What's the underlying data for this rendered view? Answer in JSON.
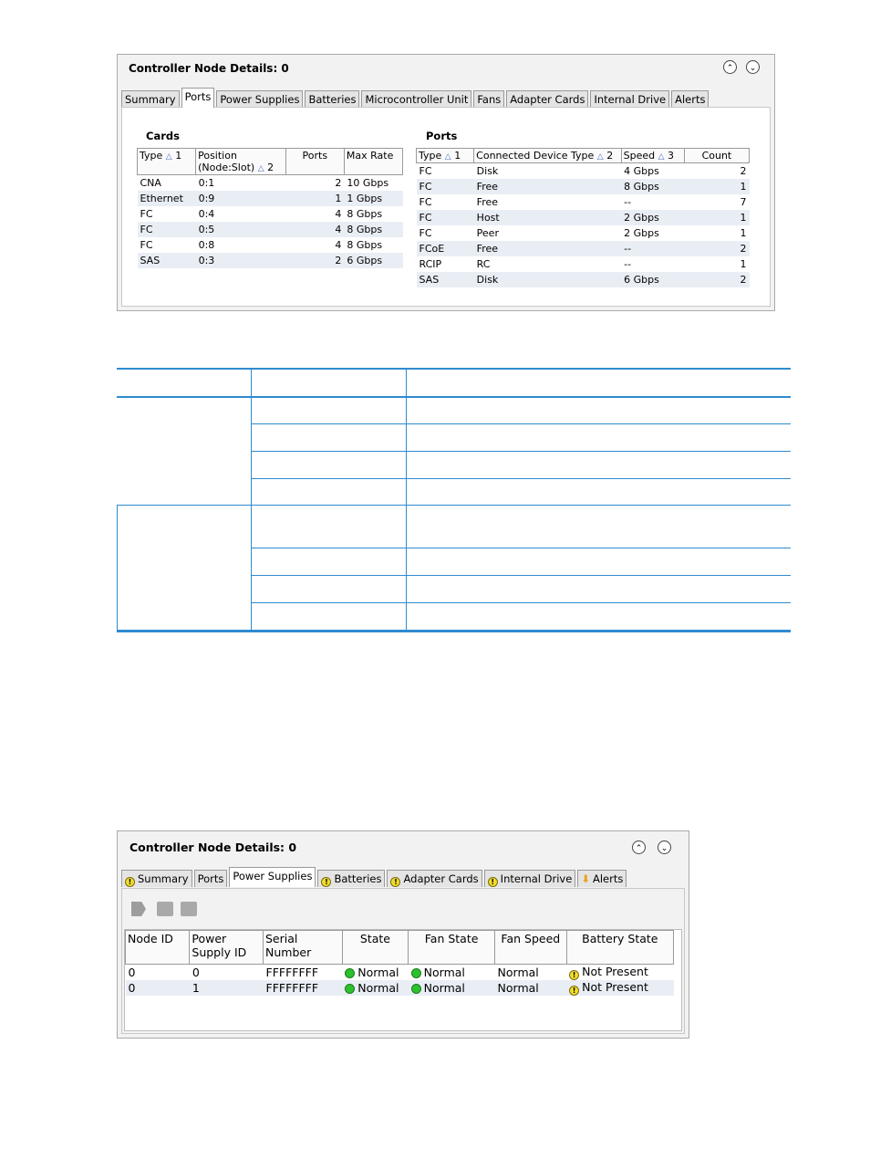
{
  "panel1": {
    "title": "Controller Node Details: 0",
    "tabs": [
      "Summary",
      "Ports",
      "Power Supplies",
      "Batteries",
      "Microcontroller Unit",
      "Fans",
      "Adapter Cards",
      "Internal Drive",
      "Alerts"
    ],
    "active_tab": "Ports",
    "cards": {
      "label": "Cards",
      "headers": [
        "Type",
        "1",
        "Position (Node:Slot)",
        "2",
        "Ports",
        "Max Rate"
      ],
      "rows": [
        [
          "CNA",
          "0:1",
          "2",
          "10 Gbps"
        ],
        [
          "Ethernet",
          "0:9",
          "1",
          "1 Gbps"
        ],
        [
          "FC",
          "0:4",
          "4",
          "8 Gbps"
        ],
        [
          "FC",
          "0:5",
          "4",
          "8 Gbps"
        ],
        [
          "FC",
          "0:8",
          "4",
          "8 Gbps"
        ],
        [
          "SAS",
          "0:3",
          "2",
          "6 Gbps"
        ]
      ]
    },
    "ports": {
      "label": "Ports",
      "headers": [
        "Type",
        "1",
        "Connected Device Type",
        "2",
        "Speed",
        "3",
        "Count"
      ],
      "rows": [
        [
          "FC",
          "Disk",
          "4 Gbps",
          "2"
        ],
        [
          "FC",
          "Free",
          "8 Gbps",
          "1"
        ],
        [
          "FC",
          "Free",
          "--",
          "7"
        ],
        [
          "FC",
          "Host",
          "2 Gbps",
          "1"
        ],
        [
          "FC",
          "Peer",
          "2 Gbps",
          "1"
        ],
        [
          "FCoE",
          "Free",
          "--",
          "2"
        ],
        [
          "RCIP",
          "RC",
          "--",
          "1"
        ],
        [
          "SAS",
          "Disk",
          "6 Gbps",
          "2"
        ]
      ]
    }
  },
  "panel2": {
    "title": "Controller Node Details: 0",
    "tabs": [
      "Summary",
      "Ports",
      "Power Supplies",
      "Batteries",
      "Adapter Cards",
      "Internal Drive",
      "Alerts"
    ],
    "active_tab": "Power Supplies",
    "toolbar_icons": [
      "export-icon",
      "print-icon",
      "copy-icon"
    ],
    "headers": [
      "Node ID",
      "Power Supply ID",
      "Serial Number",
      "State",
      "Fan State",
      "Fan Speed",
      "Battery State"
    ],
    "rows": [
      [
        "0",
        "0",
        "FFFFFFFF",
        "Normal",
        "Normal",
        "Normal",
        "Not Present"
      ],
      [
        "0",
        "1",
        "FFFFFFFF",
        "Normal",
        "Normal",
        "Normal",
        "Not Present"
      ]
    ]
  },
  "colors": {
    "doc_rule": "#2e8bd0",
    "row_alt": "#e9eef5",
    "status_ok": "#2ec12e",
    "status_warn": "#f2dc2a"
  }
}
